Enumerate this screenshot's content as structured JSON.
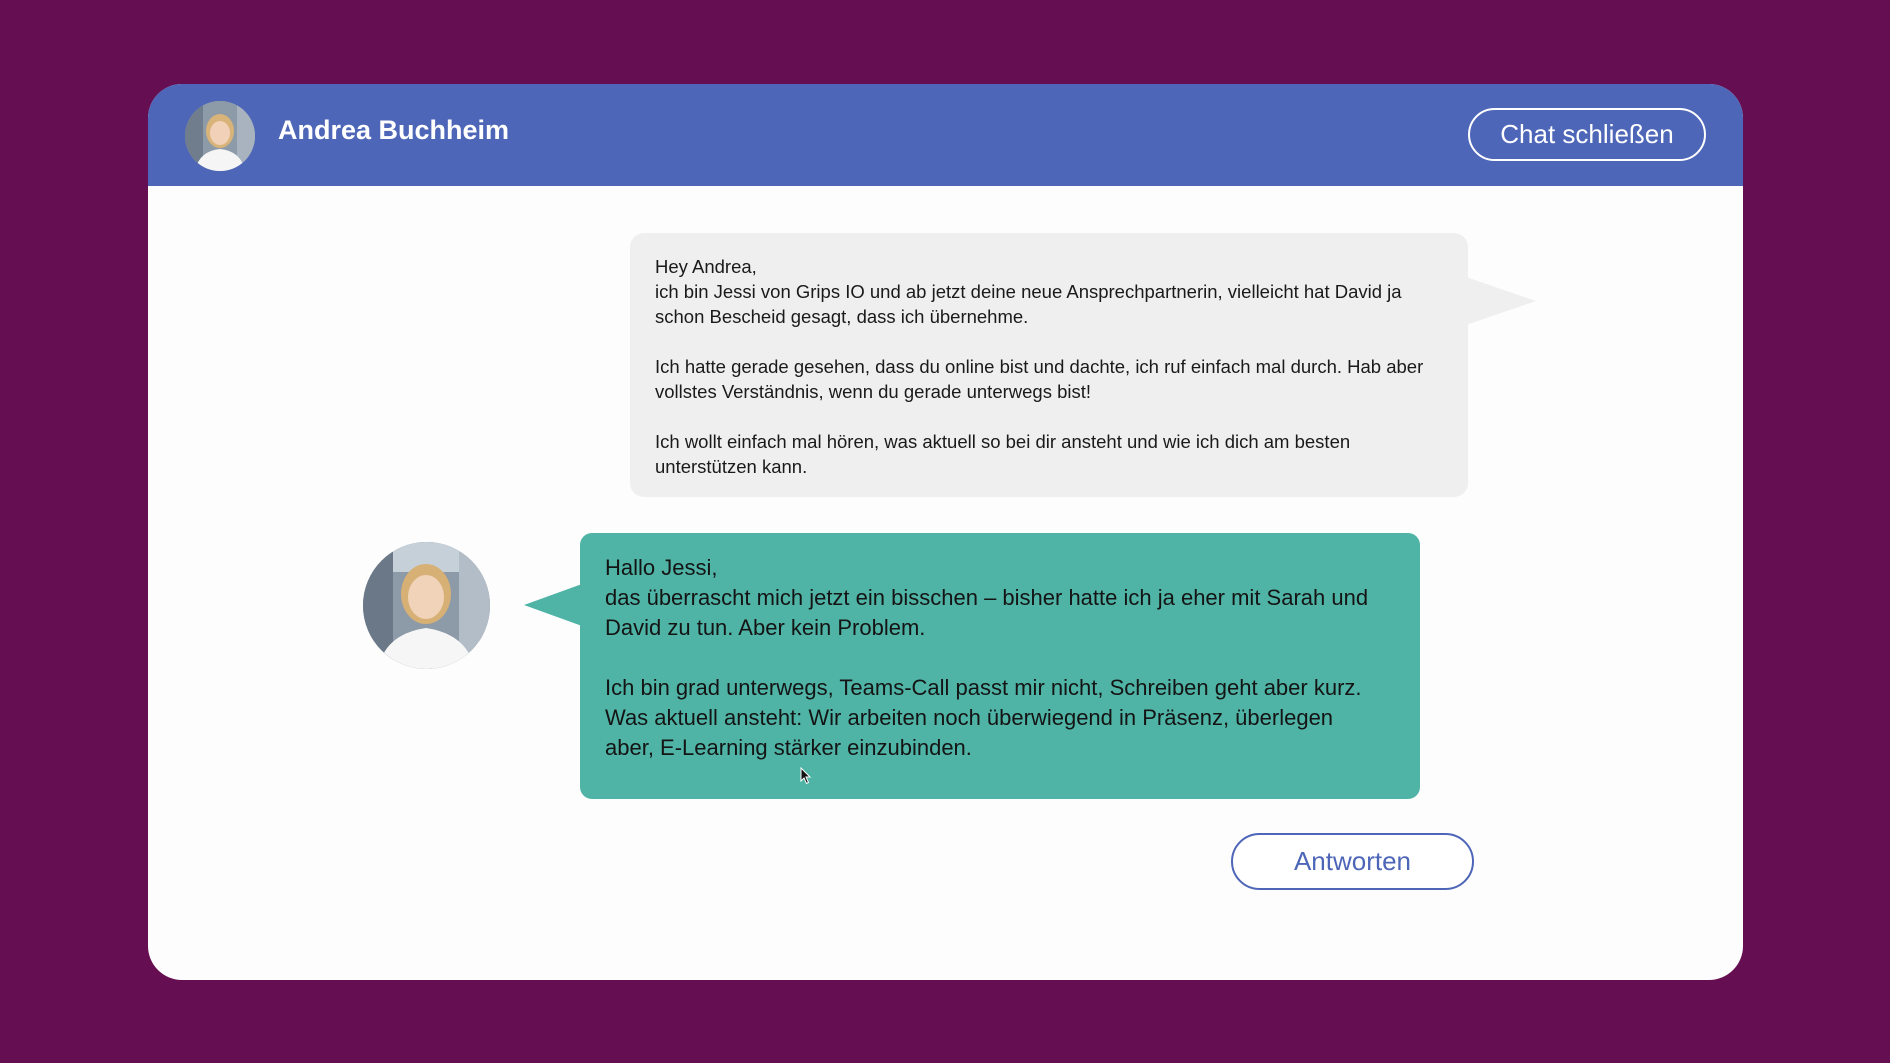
{
  "header": {
    "contact_name": "Andrea Buchheim",
    "close_label": "Chat schließen"
  },
  "messages": [
    {
      "sender": "Jessi",
      "paragraphs": [
        [
          "Hey Andrea,",
          "ich bin Jessi von Grips IO und ab jetzt deine neue Ansprechpartnerin, vielleicht hat David ja",
          "schon Bescheid gesagt, dass ich übernehme."
        ],
        [
          "Ich hatte gerade gesehen, dass du online bist und dachte, ich ruf einfach mal durch. Hab aber",
          "vollstes Verständnis, wenn du gerade unterwegs bist!"
        ],
        [
          "Ich wollt einfach mal hören, was aktuell so bei dir ansteht und wie ich dich am besten",
          "unterstützen kann."
        ]
      ]
    },
    {
      "sender": "Andrea Buchheim",
      "paragraphs": [
        [
          "Hallo Jessi,",
          "das überrascht mich jetzt ein bisschen – bisher hatte ich ja eher mit Sarah und",
          "David zu tun. Aber kein Problem."
        ],
        [
          "Ich bin grad unterwegs, Teams-Call passt mir nicht, Schreiben geht aber kurz.",
          "Was aktuell ansteht: Wir arbeiten noch überwiegend in Präsenz, überlegen",
          "aber, E-Learning stärker einzubinden."
        ]
      ]
    }
  ],
  "reply_label": "Antworten",
  "colors": {
    "background": "#650e52",
    "header": "#4e66b8",
    "outgoing_bubble": "#efefef",
    "incoming_bubble": "#4fb4a6",
    "panel": "#fdfdfd"
  }
}
